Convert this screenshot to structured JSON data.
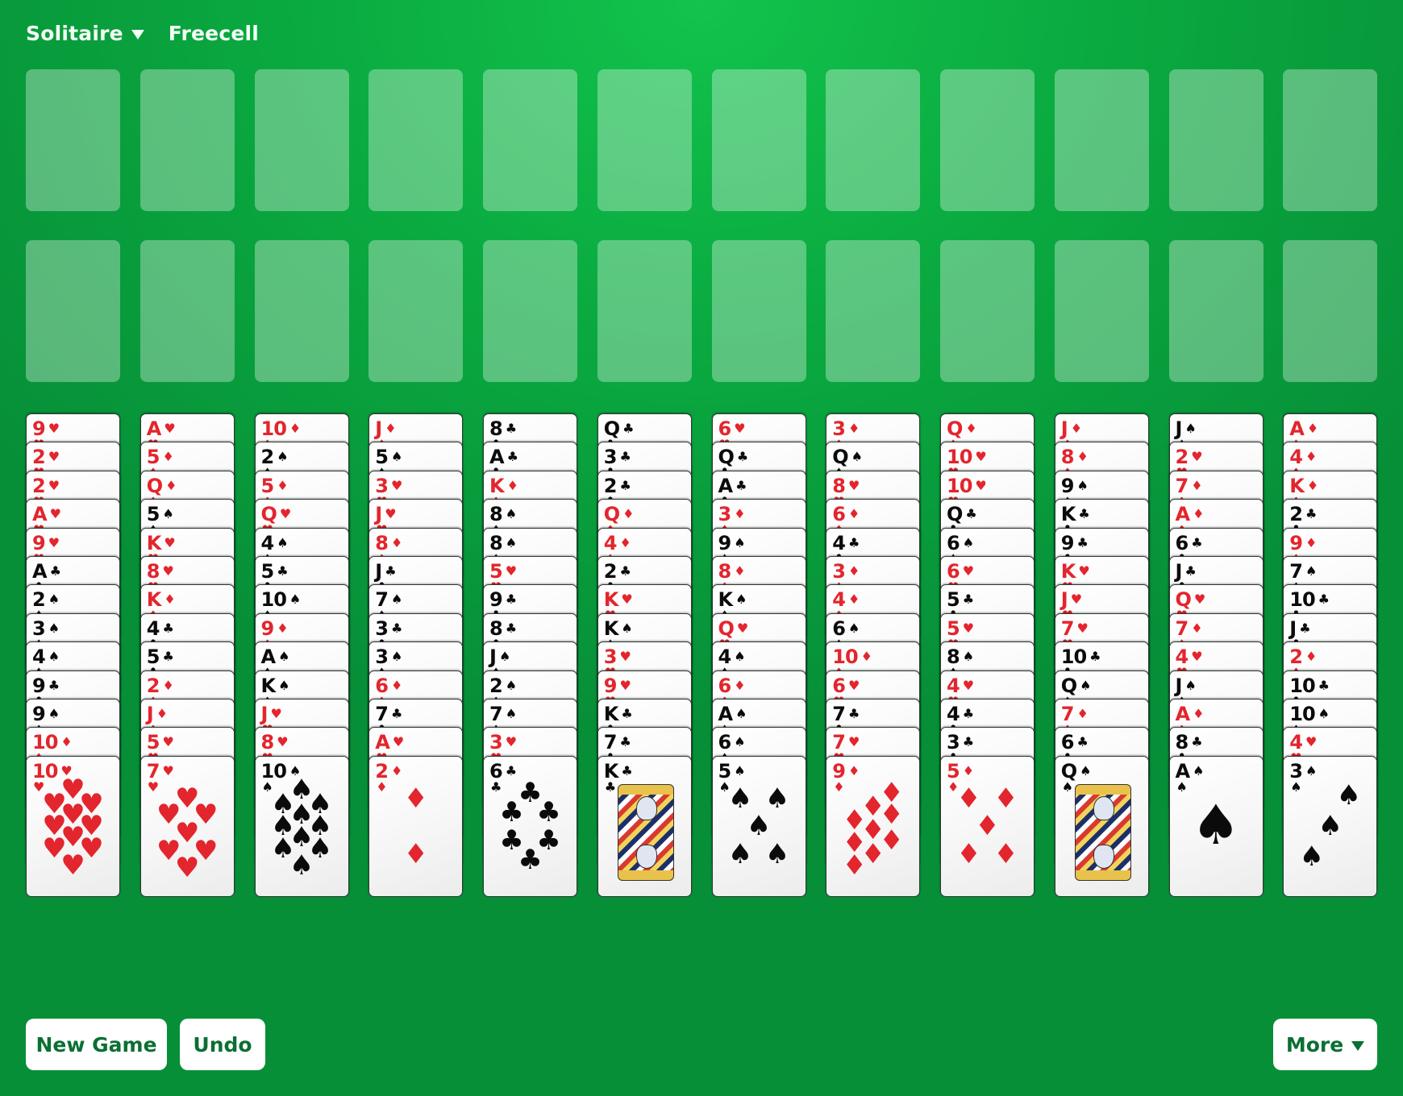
{
  "nav": {
    "game_menu_label": "Solitaire",
    "game_menu_icon": "triangle-down-icon",
    "variant_label": "Freecell"
  },
  "freecells": {
    "count": 12,
    "state": "empty"
  },
  "foundations": {
    "count": 12,
    "state": "empty"
  },
  "colors": {
    "felt": "#0aaa40",
    "felt_light": "#12c34c",
    "red_suit": "#e3252d",
    "black_suit": "#0b0b0b",
    "button_text": "#0b6f34"
  },
  "suits": {
    "hearts": {
      "glyph": "♥",
      "color": "red"
    },
    "diamonds": {
      "glyph": "♦",
      "color": "red"
    },
    "clubs": {
      "glyph": "♣",
      "color": "black"
    },
    "spades": {
      "glyph": "♠",
      "color": "black"
    }
  },
  "tableau": [
    [
      "9♥",
      "2♥",
      "2♥",
      "A♥",
      "9♥",
      "A♣",
      "2♠",
      "3♠",
      "4♠",
      "9♣",
      "9♠",
      "10♦",
      "10♥"
    ],
    [
      "A♥",
      "5♦",
      "Q♦",
      "5♠",
      "K♥",
      "8♥",
      "K♦",
      "4♣",
      "5♣",
      "2♦",
      "J♦",
      "5♥",
      "7♥"
    ],
    [
      "10♦",
      "2♠",
      "5♦",
      "Q♥",
      "4♠",
      "5♣",
      "10♠",
      "9♦",
      "A♠",
      "K♠",
      "J♥",
      "8♥",
      "10♠"
    ],
    [
      "J♦",
      "5♠",
      "3♥",
      "J♥",
      "8♦",
      "J♣",
      "7♠",
      "3♣",
      "3♠",
      "6♦",
      "7♣",
      "A♥",
      "2♦"
    ],
    [
      "8♣",
      "A♣",
      "K♦",
      "8♠",
      "8♠",
      "5♥",
      "9♣",
      "8♣",
      "J♠",
      "2♠",
      "7♠",
      "3♥",
      "6♣"
    ],
    [
      "Q♣",
      "3♣",
      "2♣",
      "Q♦",
      "4♦",
      "2♣",
      "K♥",
      "K♠",
      "3♥",
      "9♥",
      "K♣",
      "7♣",
      "K♣"
    ],
    [
      "6♥",
      "Q♣",
      "A♣",
      "3♦",
      "9♠",
      "8♦",
      "K♠",
      "Q♥",
      "4♠",
      "6♦",
      "A♠",
      "6♠",
      "5♠"
    ],
    [
      "3♦",
      "Q♠",
      "8♥",
      "6♦",
      "4♣",
      "3♦",
      "4♦",
      "6♠",
      "10♦",
      "6♥",
      "7♣",
      "7♥",
      "9♦"
    ],
    [
      "Q♦",
      "10♥",
      "10♥",
      "Q♣",
      "6♠",
      "6♥",
      "5♣",
      "5♥",
      "8♠",
      "4♥",
      "4♣",
      "3♣",
      "5♦"
    ],
    [
      "J♦",
      "8♦",
      "9♠",
      "K♣",
      "9♣",
      "K♥",
      "J♥",
      "7♥",
      "10♣",
      "Q♠",
      "7♦",
      "6♣",
      "Q♠"
    ],
    [
      "J♠",
      "2♥",
      "7♦",
      "A♦",
      "6♣",
      "J♣",
      "Q♥",
      "7♦",
      "4♥",
      "J♠",
      "A♦",
      "8♣",
      "A♠"
    ],
    [
      "A♦",
      "4♦",
      "K♦",
      "2♣",
      "9♦",
      "7♠",
      "10♣",
      "J♣",
      "2♦",
      "10♣",
      "10♠",
      "4♥",
      "3♠"
    ]
  ],
  "buttons": {
    "new_game": "New Game",
    "undo": "Undo",
    "more": "More",
    "more_icon": "triangle-down-icon"
  }
}
